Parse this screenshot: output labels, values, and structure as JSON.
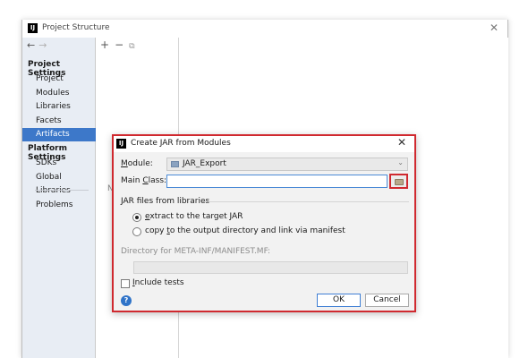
{
  "window": {
    "title": "Project Structure",
    "app_icon": "IJ",
    "close_glyph": "✕",
    "back_glyph": "←",
    "forward_glyph": "→"
  },
  "sidebar": {
    "project_settings_heading": "Project Settings",
    "project_settings_items": [
      "Project",
      "Modules",
      "Libraries",
      "Facets",
      "Artifacts"
    ],
    "selected_item": "Artifacts",
    "platform_settings_heading": "Platform Settings",
    "platform_settings_items": [
      "SDKs",
      "Global Libraries"
    ],
    "extra_items": [
      "Problems"
    ]
  },
  "middle": {
    "add_glyph": "+",
    "remove_glyph": "−",
    "copy_glyph": "⧉",
    "partial_hint": "N"
  },
  "dialog": {
    "title": "Create JAR from Modules",
    "app_icon": "IJ",
    "close_glyph": "✕",
    "module_label_mnemonic": "M",
    "module_label_rest": "odule:",
    "module_value": "JAR_Export",
    "main_class_label_a": "Main ",
    "main_class_label_mnemonic": "C",
    "main_class_label_b": "lass:",
    "main_class_value": "",
    "jar_files_group": "JAR files from libraries",
    "option_extract_mnemonic": "e",
    "option_extract_rest": "xtract to the target JAR",
    "option_copy_a": "copy ",
    "option_copy_mnemonic": "t",
    "option_copy_b": "o the output directory and link via manifest",
    "selected_option": "extract",
    "directory_label": "Directory for META-INF/MANIFEST.MF:",
    "directory_value": "",
    "include_tests_mnemonic": "I",
    "include_tests_rest": "nclude tests",
    "include_tests_checked": false,
    "help_glyph": "?",
    "ok_label": "OK",
    "cancel_label": "Cancel"
  },
  "colors": {
    "highlight_red": "#d0292f",
    "selection_blue": "#3d78c9",
    "sidebar_bg": "#e8edf4"
  }
}
